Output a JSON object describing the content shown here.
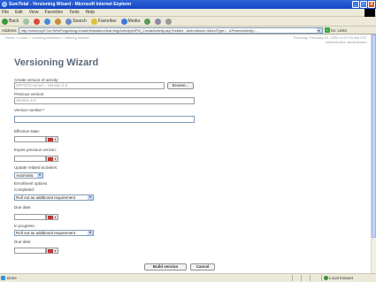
{
  "window": {
    "title": "SumTotal - Versioning Wizard - Microsoft Internet Explorer",
    "controls": [
      "_",
      "□",
      "X"
    ]
  },
  "menu": [
    "File",
    "Edit",
    "View",
    "Favorites",
    "Tools",
    "Help"
  ],
  "toolbar": {
    "back": "Back",
    "search": "Search",
    "favorites": "Favorites",
    "media": "Media"
  },
  "addressbar": {
    "label": "Address",
    "url": "http://sxstvvxp07vvr/WebFargo/lang-en/administration/learning/Activity/AIPM_CreateActivity.asp?hidden...ActionMode=3&ActType=...&ParentActivity=...",
    "go": "Go",
    "links": "Links"
  },
  "page": {
    "breadcrumb": "Home > Learn > Learning Activities > Offering Wizard",
    "datetime": "Thursday, February 02, 2006 12:37:53 AM CST",
    "user": "administrator administrator",
    "title": "Versioning Wizard"
  },
  "form": {
    "create_version_label": "Create version of activity:",
    "create_version_value": "OFFG7Course/... Version 2.0",
    "browse_button": "Browse...",
    "previous_version_label": "Previous version:",
    "previous_version_value": "Version 2.0",
    "version_number_label": "Version number:*",
    "version_number_value": "",
    "effective_date_label": "Effective Date:",
    "expire_previous_label": "Expire previous version:",
    "update_related_label": "Update related activities:",
    "update_related_value": "Automatic",
    "enrollment_options_label": "Enrollment options",
    "completed_label": "Completed:",
    "completed_value": "Roll out as additional requirement",
    "due_date_label_1": "Due date:",
    "in_progress_label": "In progress:",
    "in_progress_value": "Roll out as additional requirement",
    "due_date_label_2": "Due date:",
    "build_button": "Build version",
    "cancel_button": "Cancel"
  },
  "status": {
    "text": "Done",
    "zone": "Local intranet"
  },
  "colors": {
    "titlebar": "#1447c4",
    "page_title": "#5a6a7a",
    "chrome": "#ece9d8"
  }
}
